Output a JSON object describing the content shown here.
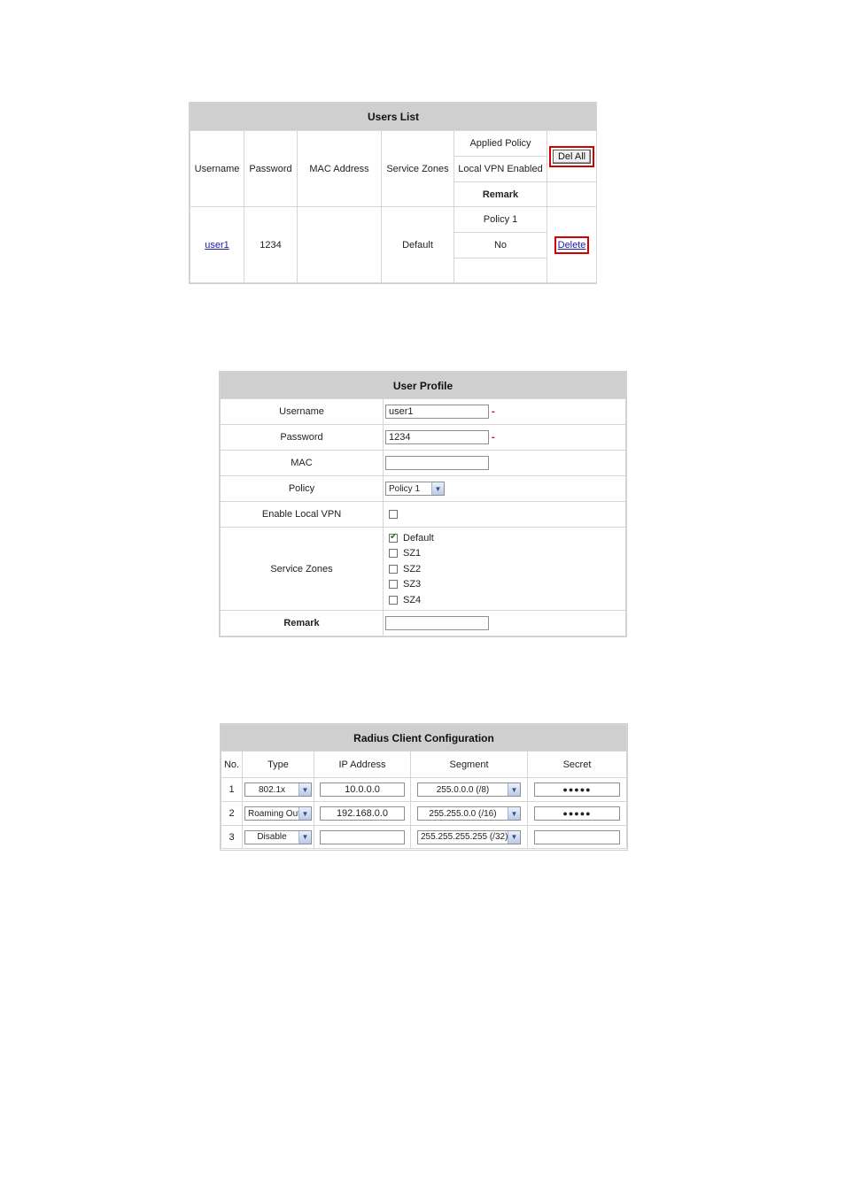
{
  "users_list": {
    "title": "Users List",
    "headers": {
      "username": "Username",
      "password": "Password",
      "mac": "MAC Address",
      "service_zones": "Service Zones",
      "applied_policy": "Applied Policy",
      "local_vpn": "Local VPN Enabled",
      "remark": "Remark",
      "del_all": "Del All"
    },
    "rows": [
      {
        "username": "user1",
        "password": "1234",
        "mac": "",
        "service_zones": "Default",
        "applied_policy": "Policy 1",
        "local_vpn": "No",
        "remark": "",
        "delete": "Delete"
      }
    ]
  },
  "user_profile": {
    "title": "User Profile",
    "username_label": "Username",
    "username_value": "user1",
    "password_label": "Password",
    "password_value": "1234",
    "required_mark": "-",
    "mac_label": "MAC",
    "mac_value": "",
    "policy_label": "Policy",
    "policy_value": "Policy 1",
    "vpn_label": "Enable Local VPN",
    "vpn_checked": false,
    "zones_label": "Service Zones",
    "zones": [
      {
        "label": "Default",
        "checked": true
      },
      {
        "label": "SZ1",
        "checked": false
      },
      {
        "label": "SZ2",
        "checked": false
      },
      {
        "label": "SZ3",
        "checked": false
      },
      {
        "label": "SZ4",
        "checked": false
      }
    ],
    "remark_label": "Remark",
    "remark_value": ""
  },
  "radius": {
    "title": "Radius Client Configuration",
    "headers": {
      "no": "No.",
      "type": "Type",
      "ip": "IP Address",
      "segment": "Segment",
      "secret": "Secret"
    },
    "rows": [
      {
        "no": "1",
        "type": "802.1x",
        "ip": "10.0.0.0",
        "segment": "255.0.0.0 (/8)",
        "secret": "●●●●●"
      },
      {
        "no": "2",
        "type": "Roaming Out",
        "ip": "192.168.0.0",
        "segment": "255.255.0.0 (/16)",
        "secret": "●●●●●"
      },
      {
        "no": "3",
        "type": "Disable",
        "ip": "",
        "segment": "255.255.255.255 (/32)",
        "secret": ""
      }
    ]
  }
}
